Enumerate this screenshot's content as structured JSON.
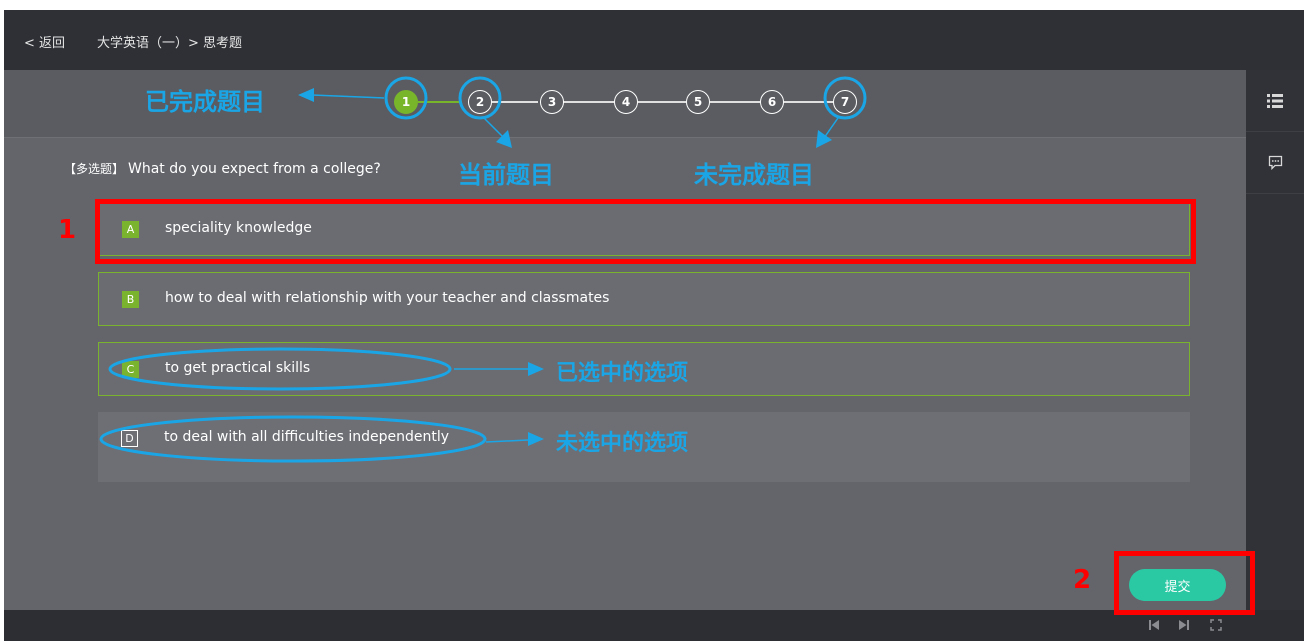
{
  "header": {
    "back_label": "< 返回",
    "breadcrumb": "大学英语（一）> 思考题"
  },
  "steps": [
    {
      "label": "1",
      "status": "completed"
    },
    {
      "label": "2",
      "status": "current"
    },
    {
      "label": "3",
      "status": "incomplete"
    },
    {
      "label": "4",
      "status": "incomplete"
    },
    {
      "label": "5",
      "status": "incomplete"
    },
    {
      "label": "6",
      "status": "incomplete"
    },
    {
      "label": "7",
      "status": "incomplete"
    }
  ],
  "question": {
    "type_tag": "【多选题】",
    "text": "What do you expect from a college?"
  },
  "options": [
    {
      "letter": "A",
      "text": "speciality knowledge",
      "selected": true
    },
    {
      "letter": "B",
      "text": "how to deal with relationship with your teacher and classmates",
      "selected": true
    },
    {
      "letter": "C",
      "text": "to get practical skills",
      "selected": true
    },
    {
      "letter": "D",
      "text": "to deal with all difficulties independently",
      "selected": false
    }
  ],
  "submit_label": "提交",
  "annotations": {
    "completed": "已完成题目",
    "current": "当前题目",
    "incomplete": "未完成题目",
    "selected_option": "已选中的选项",
    "unselected_option": "未选中的选项",
    "marker_1": "1",
    "marker_2": "2"
  },
  "icons": {
    "rail_list": "list-icon",
    "rail_comment": "comment-icon",
    "bottom_prev": "skip-previous-icon",
    "bottom_next": "skip-next-icon",
    "bottom_fullscreen": "fullscreen-icon"
  },
  "colors": {
    "accent_green": "#79b52b",
    "submit_teal": "#2bc8a4",
    "annotation_blue": "#1aa6e6",
    "annotation_red": "#ff0000"
  }
}
